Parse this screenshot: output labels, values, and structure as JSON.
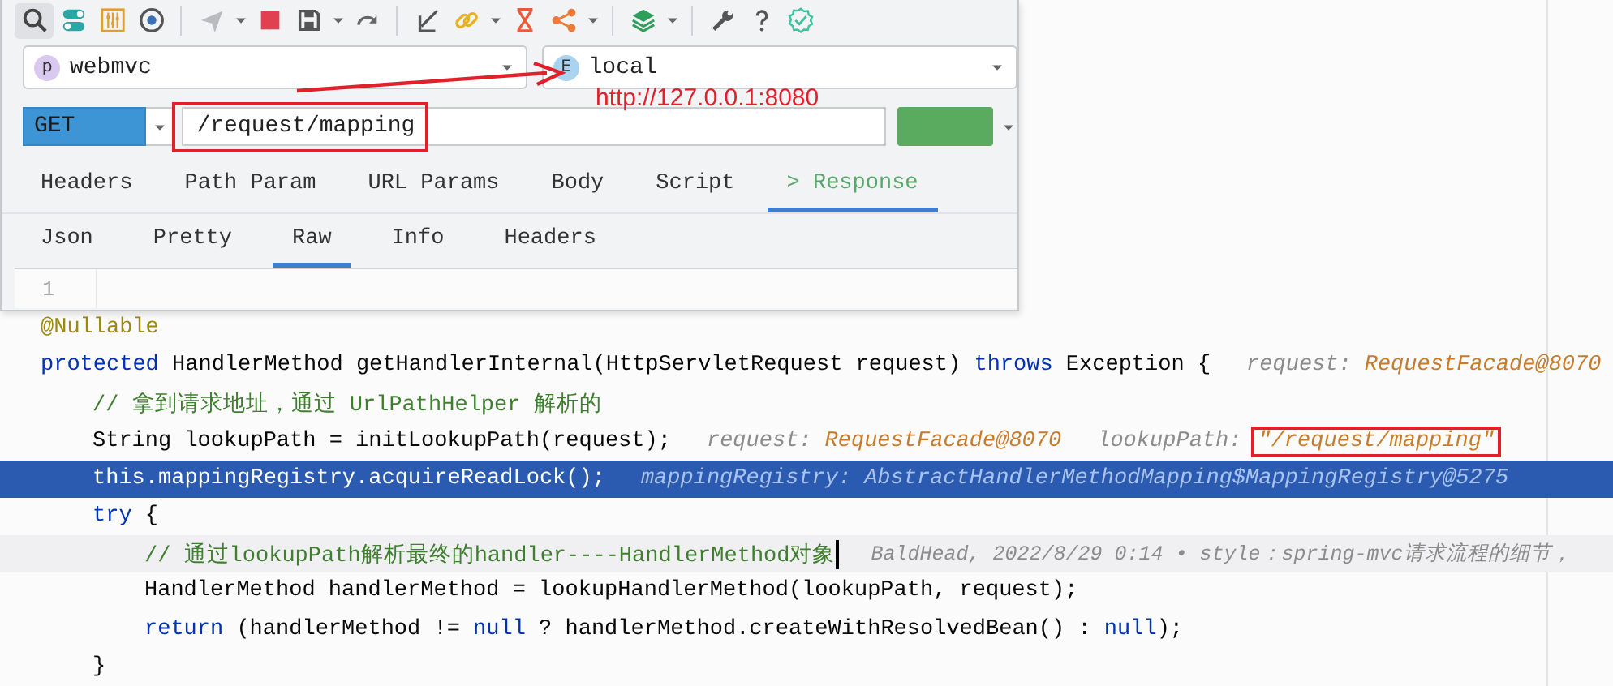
{
  "toolbar": [
    {
      "kind": "search",
      "selected": true
    },
    {
      "kind": "toggle",
      "selected": false
    },
    {
      "kind": "sliders",
      "selected": false
    },
    {
      "kind": "target",
      "selected": false
    },
    {
      "kind": "separator"
    },
    {
      "kind": "send",
      "selected": false
    },
    {
      "kind": "caret",
      "selected": false
    },
    {
      "kind": "stop",
      "selected": false
    },
    {
      "kind": "save",
      "selected": false
    },
    {
      "kind": "caret",
      "selected": false
    },
    {
      "kind": "redo",
      "selected": false
    },
    {
      "kind": "separator"
    },
    {
      "kind": "import",
      "selected": false
    },
    {
      "kind": "link",
      "selected": false
    },
    {
      "kind": "caret",
      "selected": false
    },
    {
      "kind": "hourglass",
      "selected": false
    },
    {
      "kind": "share",
      "selected": false
    },
    {
      "kind": "caret",
      "selected": false
    },
    {
      "kind": "separator"
    },
    {
      "kind": "layers",
      "selected": false
    },
    {
      "kind": "caret",
      "selected": false
    },
    {
      "kind": "separator"
    },
    {
      "kind": "wrench",
      "selected": false
    },
    {
      "kind": "help",
      "selected": false
    },
    {
      "kind": "check",
      "selected": false
    }
  ],
  "project_select": {
    "badge": "p",
    "value": "webmvc"
  },
  "environment_select": {
    "badge": "E",
    "value": "local"
  },
  "request": {
    "method": "GET",
    "url": "/request/mapping"
  },
  "tabs": [
    {
      "label": "Headers",
      "selected": false
    },
    {
      "label": "Path Param",
      "selected": false
    },
    {
      "label": "URL Params",
      "selected": false
    },
    {
      "label": "Body",
      "selected": false
    },
    {
      "label": "Script",
      "selected": false
    },
    {
      "label": "> Response",
      "selected": true
    }
  ],
  "response_tabs": [
    {
      "label": "Json",
      "selected": false
    },
    {
      "label": "Pretty",
      "selected": false
    },
    {
      "label": "Raw",
      "selected": true
    },
    {
      "label": "Info",
      "selected": false
    },
    {
      "label": "Headers",
      "selected": false
    }
  ],
  "response_editor": {
    "line_numbers": [
      "1"
    ]
  },
  "annotation": {
    "text": "http://127.0.0.1:8080"
  },
  "code_lines": [
    {
      "selected": false,
      "caret": false,
      "tokens": [
        {
          "kind": "annotation",
          "text": "@Nullable"
        }
      ]
    },
    {
      "selected": false,
      "caret": false,
      "tokens": [
        {
          "kind": "keyword",
          "text": "protected"
        },
        {
          "kind": "plain",
          "text": " HandlerMethod getHandlerInternal(HttpServletRequest request) "
        },
        {
          "kind": "keyword",
          "text": "throws"
        },
        {
          "kind": "plain",
          "text": " Exception {"
        },
        {
          "kind": "hint-name",
          "text": "request:"
        },
        {
          "kind": "hint-value",
          "text": "RequestFacade@8070"
        }
      ],
      "children": [
        {
          "selected": false,
          "caret": false,
          "tokens": [
            {
              "kind": "comment",
              "text": "// 拿到请求地址，通过 UrlPathHelper 解析的"
            }
          ]
        },
        {
          "selected": false,
          "caret": false,
          "tokens": [
            {
              "kind": "plain",
              "text": "String lookupPath = initLookupPath(request);"
            },
            {
              "kind": "hint-name",
              "text": "request:"
            },
            {
              "kind": "hint-value",
              "text": "RequestFacade@8070"
            },
            {
              "kind": "hint-name",
              "text": "lookupPath:"
            },
            {
              "kind": "boxed-hint-value",
              "text": "\"/request/mapping\""
            }
          ]
        },
        {
          "selected": true,
          "caret": false,
          "tokens": [
            {
              "kind": "plain",
              "text": "this.mappingRegistry.acquireReadLock();"
            },
            {
              "kind": "hint-name",
              "text": "mappingRegistry:"
            },
            {
              "kind": "hint-value",
              "text": "AbstractHandlerMethodMapping$MappingRegistry@5275"
            }
          ]
        },
        {
          "selected": false,
          "caret": false,
          "tokens": [
            {
              "kind": "keyword",
              "text": "try"
            },
            {
              "kind": "plain",
              "text": " {"
            }
          ],
          "children": [
            {
              "selected": false,
              "caret": true,
              "tokens": [
                {
                  "kind": "comment",
                  "text": "// 通过lookupPath解析最终的handler----HandlerMethod对象"
                },
                {
                  "kind": "blame",
                  "text": "BaldHead, 2022/8/29 0:14 • style：spring-mvc请求流程的细节，"
                }
              ]
            },
            {
              "selected": false,
              "caret": false,
              "tokens": [
                {
                  "kind": "plain",
                  "text": "HandlerMethod handlerMethod = lookupHandlerMethod(lookupPath, request);"
                }
              ]
            },
            {
              "selected": false,
              "caret": false,
              "tokens": [
                {
                  "kind": "keyword",
                  "text": "return"
                },
                {
                  "kind": "plain",
                  "text": " (handlerMethod != "
                },
                {
                  "kind": "keyword",
                  "text": "null"
                },
                {
                  "kind": "plain",
                  "text": " ? handlerMethod.createWithResolvedBean() : "
                },
                {
                  "kind": "keyword",
                  "text": "null"
                },
                {
                  "kind": "plain",
                  "text": ");"
                }
              ]
            }
          ]
        },
        {
          "selected": false,
          "caret": false,
          "tokens": [
            {
              "kind": "plain",
              "text": "}"
            }
          ]
        }
      ]
    }
  ]
}
